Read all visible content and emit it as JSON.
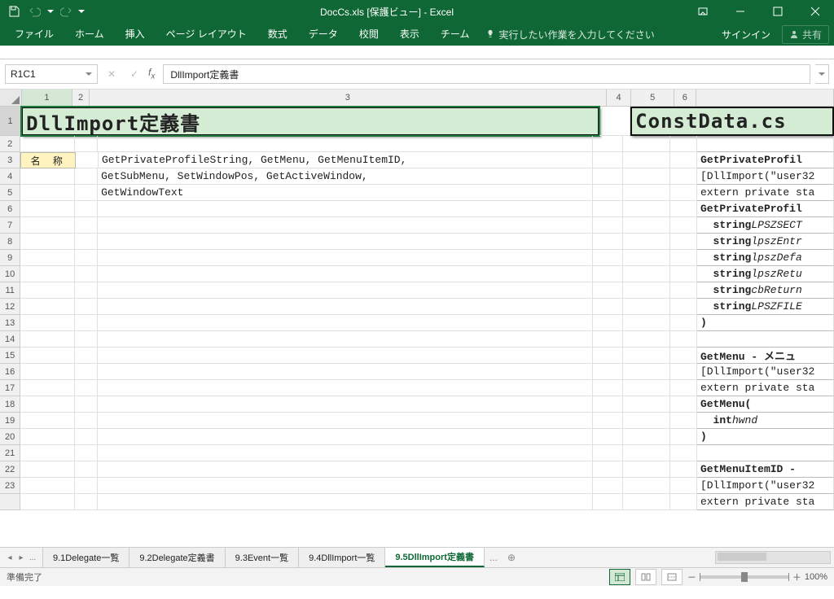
{
  "title": "DocCs.xls  [保護ビュー] - Excel",
  "qat": {
    "save": "保存",
    "undo": "元に戻す",
    "redo": "やり直し"
  },
  "tabs": {
    "file": "ファイル",
    "home": "ホーム",
    "insert": "挿入",
    "layout": "ページ レイアウト",
    "formula": "数式",
    "data": "データ",
    "review": "校閲",
    "view": "表示",
    "team": "チーム"
  },
  "tellme": "実行したい作業を入力してください",
  "signin": "サインイン",
  "share": "共有",
  "namebox": "R1C1",
  "formula": "DllImport定義書",
  "cols": {
    "c1": "1",
    "c2": "2",
    "c3": "3",
    "c4": "4",
    "c5": "5",
    "c6": "6"
  },
  "rownums": [
    "1",
    "2",
    "3",
    "4",
    "5",
    "6",
    "7",
    "8",
    "9",
    "10",
    "11",
    "12",
    "13",
    "14",
    "15",
    "16",
    "17",
    "18",
    "19",
    "20",
    "21",
    "22",
    "23"
  ],
  "maintitle": "DllImport定義書",
  "righttitle": "ConstData.cs",
  "label_name": "名 称",
  "body": {
    "l1": "GetPrivateProfileString, GetMenu, GetMenuItemID,",
    "l2": "GetSubMenu, SetWindowPos, GetActiveWindow,",
    "l3": "GetWindowText"
  },
  "code": {
    "r3": "GetPrivateProfil",
    "r4": "[DllImport(\"user32",
    "r5": "extern private sta",
    "r6": "GetPrivateProfil",
    "r7p": "string ",
    "r7i": "LPSZSECT",
    "r8p": "string ",
    "r8i": "lpszEntr",
    "r9p": "string ",
    "r9i": "lpszDefa",
    "r10p": "string ",
    "r10i": "lpszRetu",
    "r11p": "string ",
    "r11i": "cbReturn",
    "r12p": "string ",
    "r12i": "LPSZFILE",
    "r13": ")",
    "r15": "GetMenu - メニュ",
    "r16": "[DllImport(\"user32",
    "r17": "extern private sta",
    "r18": "GetMenu(",
    "r19p": "int ",
    "r19i": "hwnd",
    "r20": ")",
    "r22": "GetMenuItemID -",
    "r23": "[DllImport(\"user32",
    "r23b": "extern private sta"
  },
  "sheets": {
    "s1": "9.1Delegate一覧",
    "s2": "9.2Delegate定義書",
    "s3": "9.3Event一覧",
    "s4": "9.4DllImport一覧",
    "s5": "9.5DllImport定義書"
  },
  "status": "準備完了",
  "zoom": "100%",
  "ellipsis": "...",
  "plus": "＋",
  "minus": "－",
  "chart_data": {
    "type": "table",
    "sheet": "9.5DllImport定義書",
    "title": "DllImport定義書",
    "names": [
      "GetPrivateProfileString",
      "GetMenu",
      "GetMenuItemID",
      "GetSubMenu",
      "SetWindowPos",
      "GetActiveWindow",
      "GetWindowText"
    ],
    "source_file": "ConstData.cs"
  }
}
